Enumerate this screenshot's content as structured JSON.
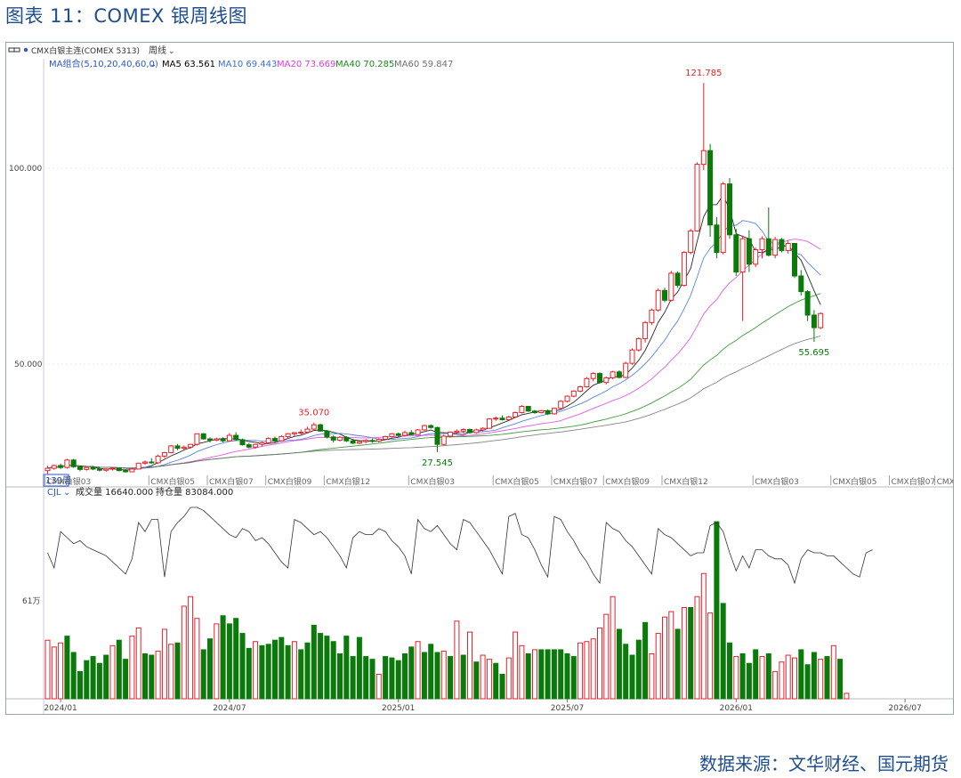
{
  "figure_title": "图表 11：COMEX 银周线图",
  "source_note": "数据来源：文华财经、国元期货",
  "header": {
    "instrument": "CMX白银主连(COMEX 5313)",
    "period": "周线",
    "ma_group": "MA组合(5,10,20,40,60,0)",
    "ma_values": [
      {
        "label": "MA5 63.561",
        "color": "#000000"
      },
      {
        "label": "MA10 69.443",
        "color": "#3b6fd8"
      },
      {
        "label": "MA20 73.669",
        "color": "#e23ce0"
      },
      {
        "label": "MA40 70.285",
        "color": "#1f8a1f"
      },
      {
        "label": "MA60 59.847",
        "color": "#707070"
      }
    ]
  },
  "indicator": {
    "name": "CJL",
    "volume_label": "成交量 16640.000",
    "oi_label": "持仓量 83084.000",
    "axis_label": "61万"
  },
  "price_axis_labels": [
    "100.000",
    "50.000"
  ],
  "contract_labels": [
    "CMX白银03",
    "CMX白银05",
    "CMX白银07",
    "CMX白银09",
    "CMX白银12",
    "CMX白银03",
    "CMX白银05",
    "CMX白银07",
    "CMX白银09",
    "CMX白银12",
    "CMX白银03",
    "CMX白银05",
    "CMX白银07",
    "CMX白"
  ],
  "week_count_label": "139周",
  "time_axis_labels": [
    "2024/01",
    "2024/07",
    "2025/01",
    "2025/07",
    "2026/01",
    "2026/07"
  ],
  "colors": {
    "up": "#e8202a",
    "down": "#0a7a0a",
    "title": "#1f4e8c",
    "high_label": "#e8202a",
    "low_label": "#0a7a0a"
  },
  "chart_data": {
    "type": "candlestick",
    "title": "图表 11：COMEX 银周线图",
    "ylim": [
      20,
      131
    ],
    "y_ticks": [
      50,
      100
    ],
    "annotations": [
      {
        "text": "121.785",
        "value": 121.785,
        "kind": "high"
      },
      {
        "text": "35.070",
        "value": 35.07,
        "kind": "high"
      },
      {
        "text": "27.545",
        "value": 27.545,
        "kind": "low"
      },
      {
        "text": "55.695",
        "value": 55.695,
        "kind": "low"
      }
    ],
    "ohlc": [
      [
        22.8,
        24.0,
        22.0,
        23.4
      ],
      [
        23.4,
        24.3,
        23.0,
        24.1
      ],
      [
        24.1,
        24.6,
        23.2,
        23.6
      ],
      [
        23.6,
        25.8,
        23.3,
        25.5
      ],
      [
        25.5,
        25.8,
        23.5,
        23.8
      ],
      [
        23.8,
        24.0,
        22.6,
        23.1
      ],
      [
        23.1,
        23.8,
        22.8,
        23.6
      ],
      [
        23.6,
        24.0,
        22.9,
        23.2
      ],
      [
        23.2,
        23.7,
        22.6,
        22.9
      ],
      [
        22.9,
        23.4,
        22.5,
        23.2
      ],
      [
        23.2,
        23.6,
        22.8,
        23.4
      ],
      [
        23.4,
        23.6,
        22.6,
        22.8
      ],
      [
        22.8,
        23.2,
        22.3,
        22.5
      ],
      [
        22.5,
        23.5,
        22.4,
        23.2
      ],
      [
        23.2,
        24.8,
        23.1,
        24.7
      ],
      [
        24.7,
        25.4,
        24.3,
        25.0
      ],
      [
        25.0,
        26.0,
        24.6,
        24.8
      ],
      [
        24.8,
        26.9,
        24.5,
        26.5
      ],
      [
        26.5,
        27.6,
        26.0,
        27.4
      ],
      [
        27.4,
        29.4,
        27.2,
        29.1
      ],
      [
        29.1,
        29.6,
        28.0,
        28.5
      ],
      [
        28.5,
        29.2,
        27.9,
        28.8
      ],
      [
        28.8,
        29.6,
        28.4,
        29.5
      ],
      [
        29.5,
        32.3,
        29.2,
        32.2
      ],
      [
        32.2,
        32.4,
        30.7,
        30.9
      ],
      [
        30.9,
        31.3,
        30.0,
        30.6
      ],
      [
        30.6,
        31.2,
        30.3,
        30.9
      ],
      [
        30.9,
        31.3,
        30.0,
        30.4
      ],
      [
        30.4,
        32.4,
        30.2,
        31.8
      ],
      [
        31.8,
        32.6,
        30.4,
        30.7
      ],
      [
        30.7,
        31.0,
        29.2,
        29.4
      ],
      [
        29.4,
        29.8,
        28.5,
        28.8
      ],
      [
        28.8,
        29.7,
        28.4,
        29.5
      ],
      [
        29.5,
        30.2,
        29.0,
        29.9
      ],
      [
        29.9,
        31.3,
        29.6,
        31.0
      ],
      [
        31.0,
        31.5,
        29.9,
        30.4
      ],
      [
        30.4,
        31.8,
        30.2,
        31.5
      ],
      [
        31.5,
        32.4,
        30.9,
        32.2
      ],
      [
        32.2,
        32.6,
        31.5,
        32.5
      ],
      [
        32.5,
        33.3,
        32.0,
        32.6
      ],
      [
        32.6,
        34.0,
        32.4,
        33.4
      ],
      [
        33.4,
        35.07,
        33.0,
        34.5
      ],
      [
        34.5,
        34.8,
        32.7,
        32.9
      ],
      [
        32.9,
        33.2,
        31.0,
        31.4
      ],
      [
        31.4,
        31.8,
        30.0,
        30.6
      ],
      [
        30.6,
        31.6,
        30.2,
        31.3
      ],
      [
        31.3,
        31.6,
        30.1,
        30.4
      ],
      [
        30.4,
        30.9,
        29.6,
        29.8
      ],
      [
        29.8,
        30.5,
        29.5,
        30.2
      ],
      [
        30.2,
        30.8,
        29.8,
        30.5
      ],
      [
        30.5,
        31.0,
        29.9,
        30.3
      ],
      [
        30.3,
        31.1,
        30.0,
        30.8
      ],
      [
        30.8,
        31.7,
        30.6,
        31.5
      ],
      [
        31.5,
        32.4,
        31.2,
        32.2
      ],
      [
        32.2,
        32.5,
        31.4,
        31.8
      ],
      [
        31.8,
        33.0,
        31.5,
        32.5
      ],
      [
        32.5,
        33.2,
        31.8,
        32.0
      ],
      [
        32.0,
        33.4,
        31.9,
        33.2
      ],
      [
        33.2,
        34.5,
        33.0,
        34.3
      ],
      [
        34.3,
        34.6,
        33.5,
        33.8
      ],
      [
        33.8,
        34.0,
        27.545,
        29.5
      ],
      [
        29.5,
        32.0,
        29.2,
        31.6
      ],
      [
        31.6,
        32.8,
        31.2,
        32.6
      ],
      [
        32.6,
        33.3,
        32.1,
        32.9
      ],
      [
        32.9,
        33.6,
        32.3,
        33.3
      ],
      [
        33.3,
        33.5,
        32.2,
        32.5
      ],
      [
        32.5,
        33.5,
        32.2,
        33.2
      ],
      [
        33.2,
        33.9,
        32.8,
        33.6
      ],
      [
        33.6,
        36.2,
        33.5,
        36.0
      ],
      [
        36.0,
        36.6,
        35.5,
        36.2
      ],
      [
        36.2,
        36.9,
        35.6,
        35.8
      ],
      [
        35.8,
        36.8,
        35.5,
        36.5
      ],
      [
        36.5,
        37.9,
        36.2,
        37.6
      ],
      [
        37.6,
        39.5,
        37.4,
        39.2
      ],
      [
        39.2,
        39.3,
        37.8,
        38.0
      ],
      [
        38.0,
        38.3,
        37.3,
        37.6
      ],
      [
        37.6,
        38.3,
        37.4,
        38.1
      ],
      [
        38.1,
        38.4,
        37.0,
        37.3
      ],
      [
        37.3,
        38.9,
        37.1,
        38.7
      ],
      [
        38.7,
        40.8,
        38.5,
        40.5
      ],
      [
        40.5,
        42.0,
        40.2,
        41.8
      ],
      [
        41.8,
        43.3,
        41.5,
        43.1
      ],
      [
        43.1,
        44.5,
        42.8,
        44.2
      ],
      [
        44.2,
        46.7,
        44.0,
        46.3
      ],
      [
        46.3,
        47.9,
        45.6,
        47.6
      ],
      [
        47.6,
        47.9,
        45.0,
        45.3
      ],
      [
        45.3,
        46.8,
        44.8,
        46.5
      ],
      [
        46.5,
        48.3,
        46.1,
        48.0
      ],
      [
        48.0,
        48.4,
        46.3,
        46.6
      ],
      [
        46.6,
        50.6,
        46.4,
        50.2
      ],
      [
        50.2,
        54.0,
        49.8,
        53.6
      ],
      [
        53.6,
        56.8,
        53.2,
        56.5
      ],
      [
        56.5,
        61.0,
        55.5,
        60.6
      ],
      [
        60.6,
        64.2,
        60.0,
        63.8
      ],
      [
        63.8,
        69.3,
        63.4,
        68.8
      ],
      [
        68.8,
        69.5,
        65.8,
        66.3
      ],
      [
        66.3,
        73.8,
        66.0,
        73.2
      ],
      [
        73.2,
        73.6,
        69.5,
        70.1
      ],
      [
        70.1,
        78.9,
        69.8,
        78.5
      ],
      [
        78.5,
        84.5,
        78.0,
        84.0
      ],
      [
        84.0,
        101.5,
        83.8,
        101.0
      ],
      [
        101.0,
        121.785,
        99.5,
        104.5
      ],
      [
        104.5,
        106.2,
        82.5,
        85.5
      ],
      [
        85.5,
        87.5,
        77.0,
        78.5
      ],
      [
        78.5,
        96.5,
        78.0,
        96.0
      ],
      [
        96.0,
        97.5,
        82.0,
        83.0
      ],
      [
        83.0,
        84.5,
        72.5,
        73.5
      ],
      [
        73.5,
        82.8,
        61.0,
        82.0
      ],
      [
        82.0,
        84.2,
        73.5,
        75.5
      ],
      [
        75.5,
        79.8,
        74.8,
        79.2
      ],
      [
        79.2,
        82.6,
        77.0,
        82.0
      ],
      [
        82.0,
        90.0,
        77.5,
        77.8
      ],
      [
        77.8,
        82.5,
        77.0,
        81.8
      ],
      [
        81.8,
        82.2,
        78.5,
        79.0
      ],
      [
        79.0,
        81.5,
        78.2,
        80.8
      ],
      [
        80.8,
        80.9,
        72.0,
        72.5
      ],
      [
        72.5,
        74.0,
        67.5,
        68.5
      ],
      [
        68.5,
        68.9,
        61.0,
        62.5
      ],
      [
        62.5,
        63.8,
        55.695,
        59.3
      ],
      [
        59.3,
        63.2,
        58.9,
        62.9
      ]
    ],
    "volume": [
      [
        4.3,
        1
      ],
      [
        3.8,
        1
      ],
      [
        4.1,
        1
      ],
      [
        4.6,
        -1
      ],
      [
        3.4,
        -1
      ],
      [
        2.0,
        -1
      ],
      [
        2.8,
        -1
      ],
      [
        3.1,
        -1
      ],
      [
        2.6,
        -1
      ],
      [
        3.2,
        -1
      ],
      [
        3.9,
        1
      ],
      [
        4.3,
        -1
      ],
      [
        2.9,
        -1
      ],
      [
        4.6,
        1
      ],
      [
        5.2,
        1
      ],
      [
        3.3,
        -1
      ],
      [
        3.2,
        -1
      ],
      [
        3.5,
        1
      ],
      [
        5.1,
        1
      ],
      [
        4.0,
        1
      ],
      [
        4.1,
        -1
      ],
      [
        6.8,
        1
      ],
      [
        7.5,
        1
      ],
      [
        5.9,
        1
      ],
      [
        3.6,
        -1
      ],
      [
        4.4,
        -1
      ],
      [
        5.5,
        1
      ],
      [
        6.1,
        -1
      ],
      [
        5.5,
        -1
      ],
      [
        5.9,
        -1
      ],
      [
        4.8,
        -1
      ],
      [
        3.7,
        -1
      ],
      [
        4.2,
        1
      ],
      [
        3.9,
        -1
      ],
      [
        4.0,
        -1
      ],
      [
        4.3,
        -1
      ],
      [
        4.5,
        -1
      ],
      [
        3.9,
        -1
      ],
      [
        4.2,
        1
      ],
      [
        3.6,
        -1
      ],
      [
        4.1,
        -1
      ],
      [
        5.4,
        -1
      ],
      [
        4.8,
        -1
      ],
      [
        4.6,
        -1
      ],
      [
        4.2,
        -1
      ],
      [
        3.3,
        -1
      ],
      [
        4.6,
        -1
      ],
      [
        3.1,
        -1
      ],
      [
        4.5,
        -1
      ],
      [
        3.1,
        -1
      ],
      [
        2.9,
        -1
      ],
      [
        1.8,
        1
      ],
      [
        3.1,
        -1
      ],
      [
        3.0,
        -1
      ],
      [
        2.8,
        -1
      ],
      [
        3.3,
        -1
      ],
      [
        3.8,
        -1
      ],
      [
        4.2,
        1
      ],
      [
        3.4,
        -1
      ],
      [
        4.0,
        -1
      ],
      [
        3.4,
        -1
      ],
      [
        3.5,
        1
      ],
      [
        3.1,
        -1
      ],
      [
        5.7,
        1
      ],
      [
        3.2,
        -1
      ],
      [
        4.9,
        1
      ],
      [
        2.7,
        -1
      ],
      [
        3.2,
        1
      ],
      [
        2.9,
        1
      ],
      [
        2.6,
        -1
      ],
      [
        1.8,
        -1
      ],
      [
        3.0,
        1
      ],
      [
        4.9,
        1
      ],
      [
        3.9,
        1
      ],
      [
        3.3,
        -1
      ],
      [
        3.6,
        1
      ],
      [
        3.6,
        -1
      ],
      [
        3.6,
        -1
      ],
      [
        3.6,
        -1
      ],
      [
        3.6,
        -1
      ],
      [
        3.3,
        -1
      ],
      [
        3.1,
        -1
      ],
      [
        4.1,
        1
      ],
      [
        4.2,
        1
      ],
      [
        4.4,
        1
      ],
      [
        5.2,
        1
      ],
      [
        6.2,
        1
      ],
      [
        7.5,
        1
      ],
      [
        5.1,
        -1
      ],
      [
        4.0,
        -1
      ],
      [
        3.2,
        -1
      ],
      [
        4.3,
        -1
      ],
      [
        5.6,
        -1
      ],
      [
        3.3,
        1
      ],
      [
        4.8,
        1
      ],
      [
        6.0,
        1
      ],
      [
        6.4,
        1
      ],
      [
        5.1,
        -1
      ],
      [
        6.7,
        1
      ],
      [
        6.7,
        -1
      ],
      [
        7.5,
        1
      ],
      [
        9.2,
        1
      ],
      [
        6.3,
        1
      ],
      [
        13.0,
        -1
      ],
      [
        7.0,
        -1
      ],
      [
        4.1,
        -1
      ],
      [
        3.1,
        1
      ],
      [
        3.3,
        -1
      ],
      [
        2.6,
        -1
      ],
      [
        3.6,
        -1
      ],
      [
        3.1,
        1
      ],
      [
        3.3,
        -1
      ],
      [
        2.0,
        1
      ],
      [
        2.7,
        1
      ],
      [
        3.2,
        1
      ],
      [
        3.0,
        1
      ],
      [
        3.6,
        -1
      ],
      [
        2.5,
        -1
      ],
      [
        3.4,
        -1
      ],
      [
        2.9,
        1
      ],
      [
        3.1,
        -1
      ],
      [
        3.9,
        1
      ],
      [
        2.9,
        -1
      ],
      [
        0.4,
        1
      ]
    ],
    "open_interest": [
      96,
      91,
      103,
      101,
      99,
      100,
      98,
      97,
      96,
      95,
      93,
      91,
      89,
      94,
      106,
      103,
      107,
      107,
      88,
      103,
      106,
      108,
      111,
      111,
      110,
      108,
      106,
      104,
      102,
      101,
      104,
      103,
      100,
      101,
      99,
      96,
      93,
      91,
      107,
      106,
      104,
      102,
      103,
      101,
      98,
      95,
      91,
      101,
      103,
      102,
      102,
      104,
      103,
      100,
      98,
      95,
      89,
      107,
      104,
      103,
      105,
      102,
      99,
      97,
      107,
      106,
      103,
      100,
      97,
      93,
      89,
      108,
      109,
      102,
      101,
      97,
      92,
      88,
      108,
      107,
      103,
      100,
      96,
      93,
      89,
      86,
      106,
      104,
      103,
      100,
      98,
      95,
      92,
      89,
      104,
      102,
      101,
      99,
      97,
      95,
      96,
      96,
      105,
      106,
      103,
      96,
      90,
      95,
      91,
      97,
      97,
      95,
      94,
      94,
      92,
      86,
      94,
      97,
      96,
      96,
      95,
      95,
      93,
      91,
      89,
      88,
      96,
      97
    ]
  }
}
